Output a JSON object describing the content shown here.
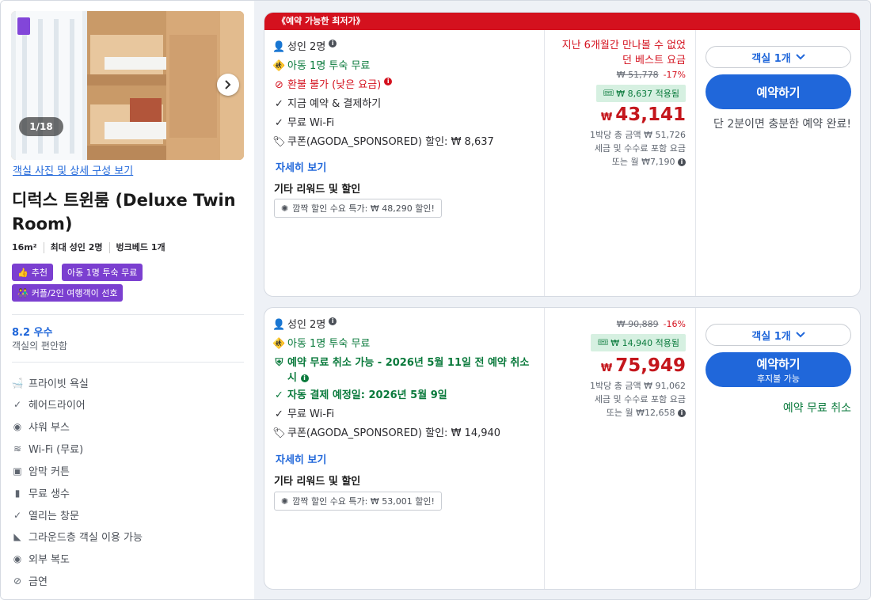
{
  "room": {
    "photo_counter": "1/18",
    "photos_link": "객실 사진 및 상세 구성 보기",
    "title": "디럭스 트윈룸 (Deluxe Twin Room)",
    "specs": [
      "16m²",
      "최대 성인 2명",
      "벙크베드 1개"
    ],
    "tags": [
      {
        "icon": "thumbs-up-icon",
        "label": "추천"
      },
      {
        "icon": "",
        "label": "아동 1명 투숙 무료"
      },
      {
        "icon": "couple-icon",
        "label": "커플/2인 여행객이 선호"
      }
    ],
    "score": "8.2 우수",
    "score_label": "객실의 편안함",
    "amenities": [
      {
        "icon": "bathtub-icon",
        "label": "프라이빗 욕실"
      },
      {
        "icon": "check-icon",
        "label": "헤어드라이어"
      },
      {
        "icon": "shower-icon",
        "label": "샤워 부스"
      },
      {
        "icon": "wifi-icon",
        "label": "Wi-Fi (무료)"
      },
      {
        "icon": "blackout-icon",
        "label": "암막 커튼"
      },
      {
        "icon": "bottle-icon",
        "label": "무료 생수"
      },
      {
        "icon": "check-icon",
        "label": "열리는 창문"
      },
      {
        "icon": "floor-icon",
        "label": "그라운드층 객실 이용 가능"
      },
      {
        "icon": "hallway-icon",
        "label": "외부 복도"
      },
      {
        "icon": "no-smoking-icon",
        "label": "금연"
      }
    ]
  },
  "offers": [
    {
      "banner": "《예약 가능한 최저가》",
      "features": [
        {
          "icon": "person-icon",
          "text": "성인 2명",
          "style": "normal",
          "info": true
        },
        {
          "icon": "child-icon",
          "text": "아동 1명 투숙 무료",
          "style": "green",
          "info": false
        },
        {
          "icon": "no-refund-icon",
          "text": "환불 불가 (낮은 요금)",
          "style": "red",
          "info": true
        },
        {
          "icon": "check-icon",
          "text": "지금 예약 & 결제하기",
          "style": "normal",
          "info": false
        },
        {
          "icon": "check-icon",
          "text": "무료 Wi-Fi",
          "style": "normal",
          "info": false
        },
        {
          "icon": "tag-icon",
          "text": "쿠폰(AGODA_SPONSORED) 할인: ₩ 8,637",
          "style": "normal",
          "info": false
        }
      ],
      "details_link": "자세히 보기",
      "rewards_title": "기타 리워드 및 할인",
      "deal": "깜짝 할인 수요 특가: ₩ 48,290 할인!",
      "best_rate": "지난 6개월간 만나볼 수 없었던 베스트 요금",
      "original_price": "₩ 51,778",
      "discount": "-17%",
      "coupon_applied": "₩ 8,637 적용됨",
      "currency": "₩",
      "price": "43,141",
      "total": "1박당 총 금액 ₩ 51,726",
      "tax_note": "세금 및 수수료 포함 요금",
      "monthly": "또는 월 ₩7,190",
      "rooms_select": "객실 1개",
      "book_label": "예약하기",
      "book_sub": "",
      "side_note": "단 2분이면 충분한 예약 완료!"
    },
    {
      "banner": "",
      "features": [
        {
          "icon": "person-icon",
          "text": "성인 2명",
          "style": "normal",
          "info": true
        },
        {
          "icon": "child-icon",
          "text": "아동 1명 투숙 무료",
          "style": "green",
          "info": false
        },
        {
          "icon": "shield-icon",
          "text": "예약 무료 취소 가능 - 2026년 5월 11일 전 예약 취소 시",
          "style": "green-bold",
          "info": true
        },
        {
          "icon": "check-icon",
          "text": "자동 결제 예정일: 2026년 5월 9일",
          "style": "green-bold",
          "info": false
        },
        {
          "icon": "check-icon",
          "text": "무료 Wi-Fi",
          "style": "normal",
          "info": false
        },
        {
          "icon": "tag-icon",
          "text": "쿠폰(AGODA_SPONSORED) 할인: ₩ 14,940",
          "style": "normal",
          "info": false
        }
      ],
      "details_link": "자세히 보기",
      "rewards_title": "기타 리워드 및 할인",
      "deal": "깜짝 할인 수요 특가: ₩ 53,001 할인!",
      "best_rate": "",
      "original_price": "₩ 90,889",
      "discount": "-16%",
      "coupon_applied": "₩ 14,940 적용됨",
      "currency": "₩",
      "price": "75,949",
      "total": "1박당 총 금액 ₩ 91,062",
      "tax_note": "세금 및 수수료 포함 요금",
      "monthly": "또는 월 ₩12,658",
      "rooms_select": "객실 1개",
      "book_label": "예약하기",
      "book_sub": "후지불 가능",
      "side_note": "예약 무료 취소"
    }
  ]
}
